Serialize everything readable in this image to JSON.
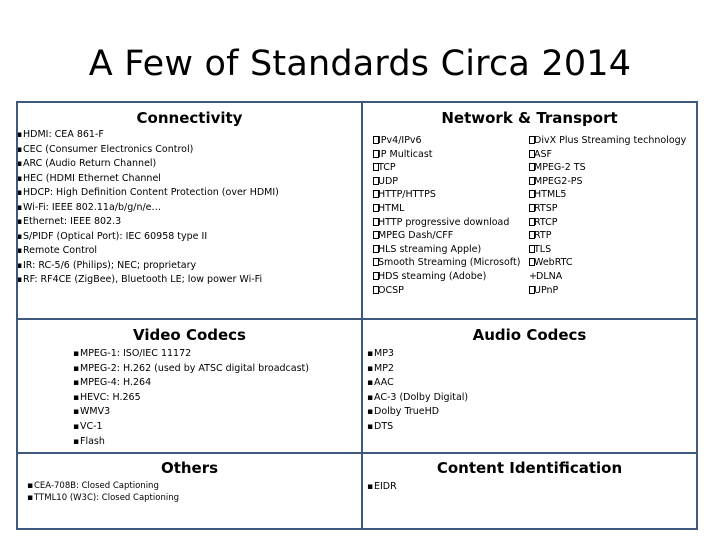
{
  "slide": {
    "title": "A Few of Standards Circa 2014",
    "border_color": "#3d5a7d",
    "background_color": "#ffffff",
    "text_color": "#000000"
  },
  "sections": {
    "connectivity": {
      "heading": "Connectivity",
      "bullet": "▪",
      "items": [
        "HDMI: CEA 861-F",
        "CEC (Consumer Electronics Control)",
        "ARC (Audio Return Channel)",
        "HEC (HDMI Ethernet Channel",
        "HDCP: High Definition Content Protection (over HDMI)",
        "Wi-Fi: IEEE 802.11a/b/g/n/e…",
        "Ethernet: IEEE 802.3",
        "S/PIDF (Optical Port): IEC 60958 type II",
        "Remote Control",
        "IR: RC-5/6 (Philips); NEC; proprietary",
        "RF: RF4CE (ZigBee), Bluetooth LE; low power Wi-Fi"
      ]
    },
    "network_transport": {
      "heading": "Network & Transport",
      "column_a": [
        "IPv4/IPv6",
        "IP Multicast",
        "TCP",
        "UDP",
        "HTTP/HTTPS",
        "HTML",
        "HTTP progressive download",
        "MPEG Dash/CFF",
        "HLS streaming Apple)",
        "Smooth Streaming (Microsoft)",
        "HDS steaming (Adobe)",
        "OCSP"
      ],
      "column_b": [
        "DivX Plus Streaming technology",
        "ASF",
        "MPEG-2 TS",
        "MPEG2-PS",
        "HTML5",
        "RTSP",
        "RTCP",
        "RTP",
        "TLS",
        "WebRTC",
        "DLNA",
        "UPnP"
      ],
      "column_b_prefixes": [
        "box",
        "box",
        "box",
        "box",
        "box",
        "box",
        "box",
        "box",
        "box",
        "box",
        "plus",
        "box"
      ],
      "plus_symbol": "+"
    },
    "video_codecs": {
      "heading": "Video Codecs",
      "bullet": "▪",
      "items": [
        "MPEG-1: ISO/IEC 11172",
        "MPEG-2: H.262 (used by ATSC digital broadcast)",
        "MPEG-4: H.264",
        "HEVC: H.265",
        "WMV3",
        "VC-1",
        "Flash"
      ]
    },
    "audio_codecs": {
      "heading": "Audio Codecs",
      "bullet": "▪",
      "items": [
        "MP3",
        "MP2",
        "AAC",
        "AC-3 (Dolby Digital)",
        "Dolby TrueHD",
        "DTS"
      ]
    },
    "others": {
      "heading": "Others",
      "bullet": "▪",
      "items": [
        "CEA-708B: Closed Captioning",
        "TTML10 (W3C): Closed Captioning"
      ]
    },
    "content_identification": {
      "heading": "Content Identification",
      "bullet": "▪",
      "items": [
        "EIDR"
      ]
    }
  }
}
